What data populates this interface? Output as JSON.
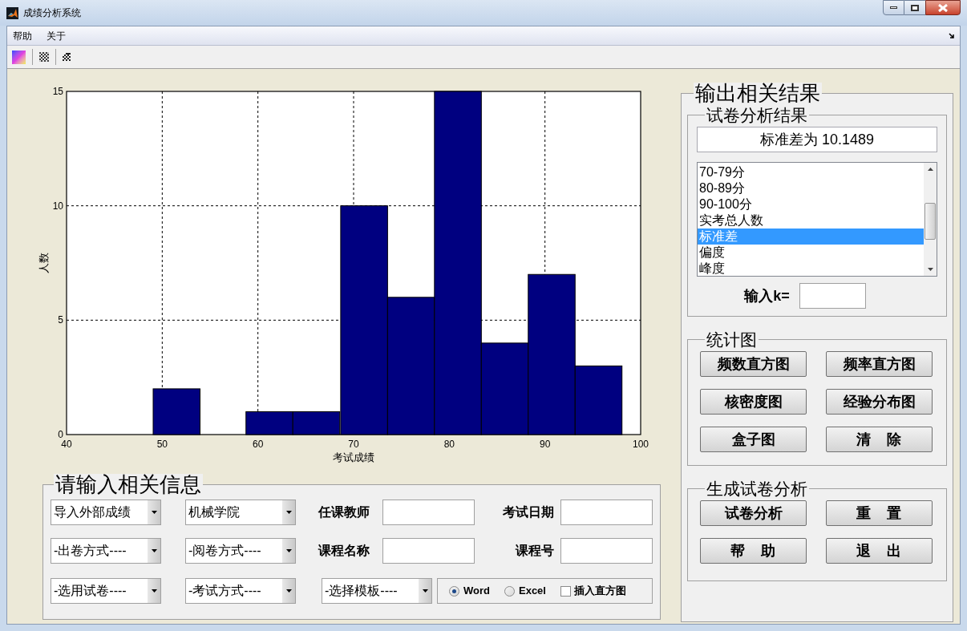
{
  "window": {
    "title": "成绩分析系统"
  },
  "menu": [
    {
      "label": "帮助"
    },
    {
      "label": "关于"
    }
  ],
  "chart": {
    "chart_data": {
      "type": "bar",
      "xlabel": "考试成绩",
      "ylabel": "人数",
      "x": [
        51.5,
        56.4,
        61.2,
        66.1,
        71.1,
        76.0,
        80.9,
        85.8,
        90.7,
        95.6
      ],
      "values": [
        2,
        0,
        1,
        1,
        10,
        6,
        15,
        4,
        7,
        3
      ],
      "xlim": [
        40,
        100
      ],
      "ylim": [
        0,
        15
      ],
      "xticks": [
        40,
        50,
        60,
        70,
        80,
        90,
        100
      ],
      "yticks": [
        0,
        5,
        10,
        15
      ],
      "grid": true
    }
  },
  "info_panel": {
    "title": "请输入相关信息",
    "rows": [
      {
        "dropdowns": [
          "导入外部成绩",
          "机械学院"
        ],
        "fields": [
          {
            "label": "任课教师"
          },
          {
            "label": "考试日期"
          }
        ]
      },
      {
        "dropdowns": [
          "-出卷方式----",
          "-阅卷方式----"
        ],
        "fields": [
          {
            "label": "课程名称"
          },
          {
            "label": "课程号"
          }
        ]
      }
    ],
    "last_row": {
      "dropdowns": [
        "-选用试卷----",
        "-考试方式----",
        "-选择模板----"
      ],
      "radios": [
        {
          "label": "Word",
          "selected": true
        },
        {
          "label": "Excel",
          "selected": false
        }
      ],
      "checkbox": {
        "label": "插入直方图",
        "checked": false
      }
    }
  },
  "results_panel": {
    "title": "输出相关结果",
    "analysis": {
      "title": "试卷分析结果",
      "result": "标准差为 10.1489",
      "list": [
        {
          "label": "70-79分",
          "selected": false
        },
        {
          "label": "80-89分",
          "selected": false
        },
        {
          "label": "90-100分",
          "selected": false
        },
        {
          "label": "实考总人数",
          "selected": false
        },
        {
          "label": "标准差",
          "selected": true
        },
        {
          "label": "偏度",
          "selected": false
        },
        {
          "label": "峰度",
          "selected": false
        }
      ],
      "k_label": "输入k="
    },
    "charts_group": {
      "title": "统计图",
      "buttons": [
        "频数直方图",
        "频率直方图",
        "核密度图",
        "经验分布图",
        "盒子图",
        "清    除"
      ]
    },
    "generate_group": {
      "title": "生成试卷分析",
      "buttons": [
        "试卷分析",
        "重    置",
        "帮    助",
        "退    出"
      ]
    }
  }
}
